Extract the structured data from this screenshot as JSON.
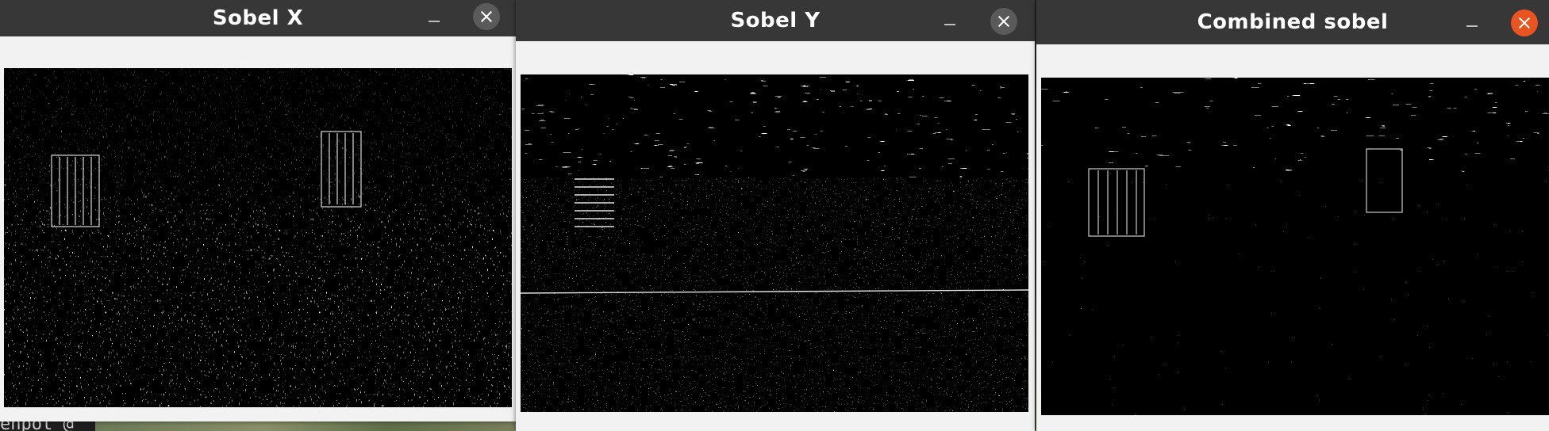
{
  "windows": [
    {
      "title": "Sobel X",
      "close_active": false,
      "pattern": "sobel-x"
    },
    {
      "title": "Sobel Y",
      "close_active": false,
      "pattern": "sobel-y"
    },
    {
      "title": "Combined sobel",
      "close_active": true,
      "pattern": "combined"
    }
  ],
  "background": {
    "terminal_text": "enpot @"
  },
  "colors": {
    "titlebar": "#373737",
    "close_active": "#e95420",
    "close_inactive": "#5a5a5a",
    "window_body": "#f2f2f2"
  },
  "icons": {
    "minimize": "minimize-icon",
    "close": "close-icon"
  }
}
